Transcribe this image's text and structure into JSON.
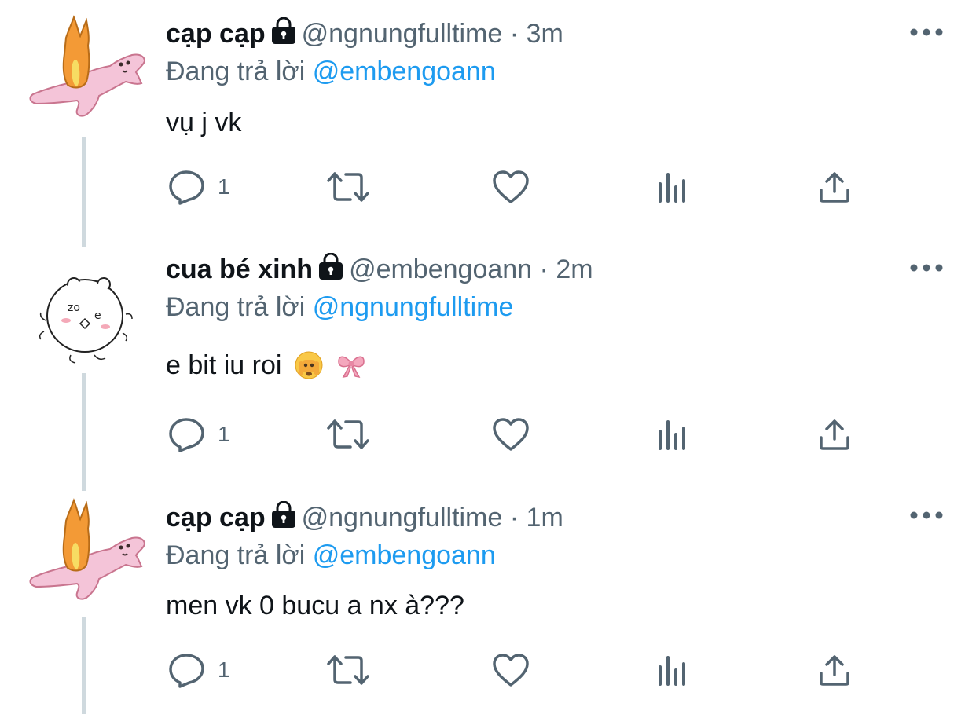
{
  "tweets": [
    {
      "name": "cạp cạp",
      "handle": "@ngnungfulltime",
      "sep": "·",
      "time": "3m",
      "reply_prefix": "Đang trả lời",
      "reply_to": "@embengoann",
      "text": "vụ j vk",
      "reply_count": "1",
      "avatar": "bunny-carrot-sticker"
    },
    {
      "name": "cua bé xinh",
      "handle": "@embengoann",
      "sep": "·",
      "time": "2m",
      "reply_prefix": "Đang trả lời",
      "reply_to": "@ngnungfulltime",
      "text": "e bit iu roi",
      "emojis": [
        "face-with-peeking-eye",
        "pink-ribbon"
      ],
      "reply_count": "1",
      "avatar": "round-doodle-creature"
    },
    {
      "name": "cạp cạp",
      "handle": "@ngnungfulltime",
      "sep": "·",
      "time": "1m",
      "reply_prefix": "Đang trả lời",
      "reply_to": "@embengoann",
      "text": "men vk 0 bucu a nx à???",
      "reply_count": "1",
      "avatar": "bunny-carrot-sticker"
    }
  ],
  "colors": {
    "text": "#0f1419",
    "secondary": "#536471",
    "link": "#1d9bf0",
    "thread_line": "#cfd9de"
  },
  "icons": [
    "lock-icon",
    "more-icon",
    "reply-icon",
    "retweet-icon",
    "like-icon",
    "analytics-icon",
    "share-icon"
  ]
}
